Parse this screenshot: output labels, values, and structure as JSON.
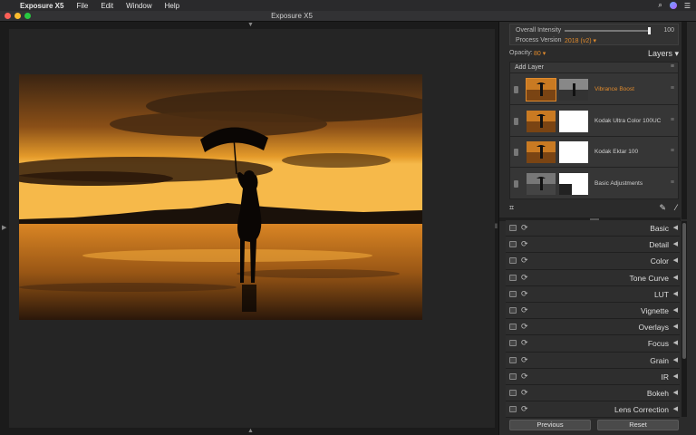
{
  "menubar": {
    "app": "Exposure X5",
    "items": [
      "File",
      "Edit",
      "Window",
      "Help"
    ]
  },
  "window": {
    "title": "Exposure X5"
  },
  "intensity": {
    "label": "Overall Intensity",
    "value": "100",
    "level": 1.0,
    "process_label": "Process Version",
    "process_value": "2018 (v2)"
  },
  "opacity": {
    "label": "Opacity:",
    "value": "80",
    "layers_label": "Layers"
  },
  "layers": {
    "add_label": "Add Layer",
    "items": [
      {
        "name": "Vibrance Boost",
        "active": true
      },
      {
        "name": "Kodak Ultra Color 100UC",
        "active": false
      },
      {
        "name": "Kodak Ektar 100",
        "active": false
      },
      {
        "name": "Basic Adjustments",
        "active": false
      }
    ]
  },
  "adjustments": [
    "Basic",
    "Detail",
    "Color",
    "Tone Curve",
    "LUT",
    "Vignette",
    "Overlays",
    "Focus",
    "Grain",
    "IR",
    "Bokeh",
    "Lens Correction"
  ],
  "buttons": {
    "previous": "Previous",
    "reset": "Reset"
  },
  "colors": {
    "accent": "#e08a2c",
    "panel": "#2b2b2b"
  }
}
